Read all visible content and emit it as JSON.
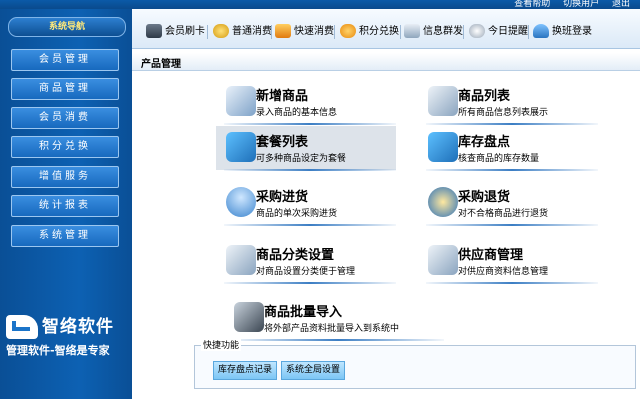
{
  "top_links": [
    "查看帮助",
    "切换用户",
    "退出"
  ],
  "sidebar": {
    "header": "系统导航",
    "items": [
      {
        "label": "会员管理"
      },
      {
        "label": "商品管理"
      },
      {
        "label": "会员消费"
      },
      {
        "label": "积分兑换"
      },
      {
        "label": "增值服务"
      },
      {
        "label": "统计报表"
      },
      {
        "label": "系统管理"
      }
    ],
    "logo_name": "智络软件",
    "logo_slogan": "管理软件-智络是专家"
  },
  "toolbar": {
    "items": [
      {
        "label": "会员刷卡",
        "icon": "card-icon"
      },
      {
        "label": "普通消费",
        "icon": "coin-icon"
      },
      {
        "label": "快速消费",
        "icon": "bag-icon"
      },
      {
        "label": "积分兑换",
        "icon": "exchange-icon"
      },
      {
        "label": "信息群发",
        "icon": "message-icon"
      },
      {
        "label": "今日提醒",
        "icon": "clock-icon"
      },
      {
        "label": "换班登录",
        "icon": "shift-icon"
      }
    ]
  },
  "section_title": "产品管理",
  "menu": [
    {
      "title": "新增商品",
      "desc": "录入商品的基本信息",
      "icon": "add-product-icon"
    },
    {
      "title": "商品列表",
      "desc": "所有商品信息列表展示",
      "icon": "product-list-icon"
    },
    {
      "title": "套餐列表",
      "desc": "可多种商品设定为套餐",
      "icon": "package-icon"
    },
    {
      "title": "库存盘点",
      "desc": "核查商品的库存数量",
      "icon": "inventory-icon"
    },
    {
      "title": "采购进货",
      "desc": "商品的单次采购进货",
      "icon": "purchase-icon"
    },
    {
      "title": "采购退货",
      "desc": "对不合格商品进行退货",
      "icon": "return-icon"
    },
    {
      "title": "商品分类设置",
      "desc": "对商品设置分类便于管理",
      "icon": "category-icon"
    },
    {
      "title": "供应商管理",
      "desc": "对供应商资料信息管理",
      "icon": "supplier-icon"
    },
    {
      "title": "商品批量导入",
      "desc": "将外部产品资料批量导入到系统中",
      "icon": "import-icon"
    }
  ],
  "shortcuts": {
    "title": "快捷功能",
    "buttons": [
      "库存盘点记录",
      "系统全局设置"
    ]
  },
  "colors": {
    "sidebar": "#0d61b3",
    "nav_button": "#2c80d4",
    "shortcut_button": "#8fd0fa",
    "accent_line": "#3c7ec4"
  }
}
